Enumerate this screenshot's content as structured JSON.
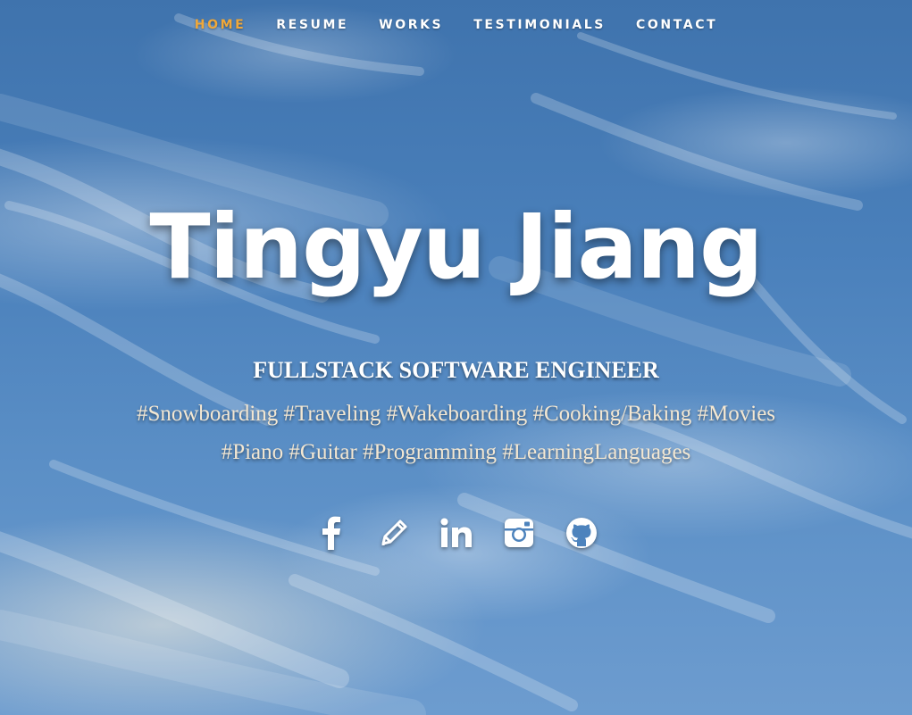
{
  "nav": {
    "items": [
      {
        "label": "HOME",
        "active": true
      },
      {
        "label": "RESUME",
        "active": false
      },
      {
        "label": "WORKS",
        "active": false
      },
      {
        "label": "TESTIMONIALS",
        "active": false
      },
      {
        "label": "CONTACT",
        "active": false
      }
    ],
    "active_color": "#f0a839"
  },
  "hero": {
    "name": "Tingyu Jiang",
    "role": "FULLSTACK SOFTWARE ENGINEER",
    "tags_line1": "#Snowboarding #Traveling #Wakeboarding #Cooking/Baking #Movies",
    "tags_line2": "#Piano #Guitar #Programming #LearningLanguages"
  },
  "socials": [
    {
      "icon": "facebook-icon"
    },
    {
      "icon": "pencil-icon"
    },
    {
      "icon": "linkedin-icon"
    },
    {
      "icon": "instagram-icon"
    },
    {
      "icon": "github-icon"
    }
  ],
  "colors": {
    "sky": "#4a80bb",
    "text": "#ffffff",
    "tags": "#f3e7d2"
  }
}
